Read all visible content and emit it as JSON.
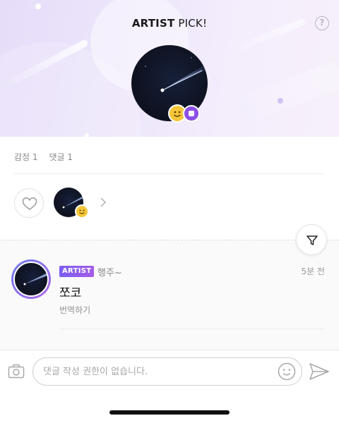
{
  "header": {
    "title_bold": "ARTIST",
    "title_rest": " PICK!",
    "help_icon": "question-circle-icon"
  },
  "counts": {
    "emotion_label": "감정 1",
    "comment_label": "댓글 1"
  },
  "reactions": {
    "like_icon": "heart-outline-icon",
    "more_icon": "chevron-right-icon"
  },
  "comment": {
    "badge": "ARTIST",
    "author": "행주~",
    "time": "5분 전",
    "body": "쪼코",
    "translate": "번역하기"
  },
  "filter": {
    "icon": "filter-icon"
  },
  "composer": {
    "placeholder": "댓글 작성 권한이 없습니다.",
    "camera_icon": "camera-icon",
    "emoji_icon": "smiley-icon",
    "send_icon": "send-icon"
  },
  "colors": {
    "accent_purple": "#8c4fe6",
    "badge_yellow": "#f6c63a",
    "banner_lavender": "#e6ddf9"
  }
}
